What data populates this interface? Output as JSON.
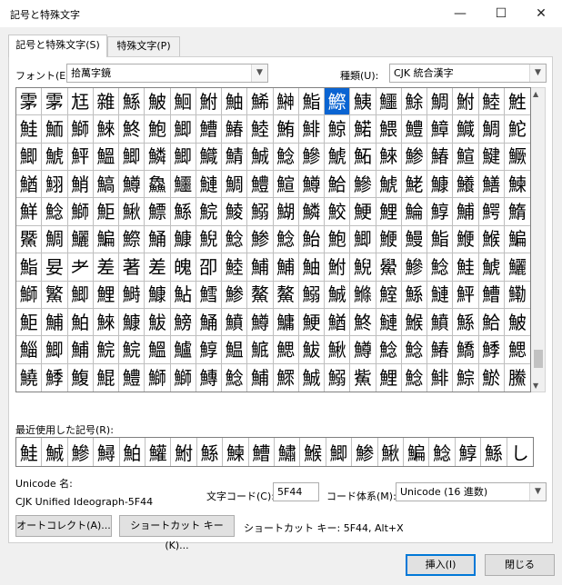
{
  "window": {
    "title": "記号と特殊文字",
    "minimize": "—",
    "maximize": "☐",
    "close": "✕"
  },
  "tabs": [
    {
      "label": "記号と特殊文字(S)"
    },
    {
      "label": "特殊文字(P)"
    }
  ],
  "font": {
    "label": "フォント(E):",
    "value": "拾萬字鏡"
  },
  "subset": {
    "label": "種類(U):",
    "value": "CJK 統合漢字"
  },
  "symbols": [
    [
      "雺",
      "雺",
      "尪",
      "雜",
      "鯀",
      "鮍",
      "鮰",
      "鮒",
      "鮋",
      "鯑",
      "鰰",
      "鮨",
      "鰶",
      "鮧",
      "鱷",
      "鮽",
      "鯛",
      "鮒",
      "鯥",
      "鮏"
    ],
    [
      "鮭",
      "鮞",
      "鰤",
      "鯠",
      "鮗",
      "鮑",
      "鯽",
      "鰽",
      "鰆",
      "鯥",
      "鮪",
      "鯡",
      "鯨",
      "鰙",
      "鰃",
      "鱧",
      "鱆",
      "鱵",
      "鯛",
      "鮀"
    ],
    [
      "鯽",
      "鯱",
      "鮃",
      "鰮",
      "鯽",
      "鱗",
      "鯽",
      "鱵",
      "鯖",
      "鯎",
      "鯰",
      "鰺",
      "鯱",
      "鮖",
      "鯠",
      "鯵",
      "鰆",
      "鰚",
      "鰎",
      "鱖"
    ],
    [
      "鰌",
      "鮙",
      "鮹",
      "鰝",
      "鱒",
      "鱻",
      "鱷",
      "鰱",
      "鯛",
      "鱧",
      "鰚",
      "鱒",
      "鮯",
      "鰺",
      "鯱",
      "鮱",
      "鱇",
      "鱶",
      "鱔",
      "鰊"
    ],
    [
      "鮮",
      "鯰",
      "鰤",
      "鮔",
      "鰍",
      "鰾",
      "鯀",
      "鯇",
      "鯪",
      "鰯",
      "鰗",
      "鱗",
      "鮫",
      "鯁",
      "鯉",
      "鯩",
      "鯙",
      "鯆",
      "鰐",
      "鰖"
    ],
    [
      "鱀",
      "鯛",
      "鱺",
      "鯿",
      "鰶",
      "鯒",
      "鱇",
      "鯢",
      "鯰",
      "鯵",
      "鯰",
      "鮐",
      "鮑",
      "鯽",
      "鯾",
      "鰻",
      "鮨",
      "鯾",
      "鯸",
      "鯿"
    ],
    [
      "鮨",
      "妟",
      "耂",
      "差",
      "著",
      "差",
      "魄",
      "卲",
      "鯥",
      "鯆",
      "鯆",
      "鮋",
      "鮒",
      "鯢",
      "鱟",
      "鰺",
      "鯰",
      "鮭",
      "鯱",
      "鱺"
    ],
    [
      "鰤",
      "鰵",
      "鯽",
      "鯉",
      "鰣",
      "鱇",
      "鮎",
      "鱈",
      "鯵",
      "鰲",
      "鰲",
      "鰯",
      "鯎",
      "鰷",
      "鰘",
      "鯀",
      "鰱",
      "鮃",
      "鰽",
      "鰳"
    ],
    [
      "鮔",
      "鯆",
      "鮊",
      "鯠",
      "鱇",
      "鮁",
      "鰟",
      "鯒",
      "鱝",
      "鱒",
      "鱅",
      "鯁",
      "鰌",
      "鮗",
      "鰱",
      "鯸",
      "鱝",
      "鯀",
      "鮯",
      "鮍"
    ],
    [
      "鯔",
      "鯽",
      "鯆",
      "鯇",
      "鯇",
      "鰮",
      "鱸",
      "鯙",
      "鰛",
      "鯳",
      "鰓",
      "鮁",
      "鰍",
      "鱒",
      "鯰",
      "鯰",
      "鰆",
      "鱎",
      "鯚",
      "鰓"
    ],
    [
      "鱙",
      "鯚",
      "鰒",
      "鯤",
      "鱧",
      "鰤",
      "鰤",
      "鱄",
      "鯰",
      "鯆",
      "鰥",
      "鯎",
      "鰯",
      "鮆",
      "鯉",
      "鯰",
      "鯡",
      "鯮",
      "鯲",
      "鰧"
    ]
  ],
  "selected": {
    "row": 0,
    "col": 12
  },
  "recent_label": "最近使用した記号(R):",
  "recent": [
    "鮭",
    "鯎",
    "鰺",
    "鱘",
    "鮊",
    "鱹",
    "鮒",
    "鯀",
    "鰊",
    "鰽",
    "鱐",
    "鯸",
    "鯽",
    "鯵",
    "鰍",
    "鯿",
    "鯰",
    "鯙",
    "鯀",
    "し"
  ],
  "unicode": {
    "name_label": "Unicode 名:",
    "name_value": "CJK Unified Ideograph-5F44"
  },
  "code": {
    "label": "文字コード(C):",
    "value": "5F44"
  },
  "code_system": {
    "label": "コード体系(M):",
    "value": "Unicode (16 進数)"
  },
  "buttons": {
    "autocorrect": "オートコレクト(A)...",
    "shortcut": "ショートカット キー(K)...",
    "insert": "挿入(I)",
    "close": "閉じる"
  },
  "shortcut_text": "ショートカット キー: 5F44, Alt+X"
}
